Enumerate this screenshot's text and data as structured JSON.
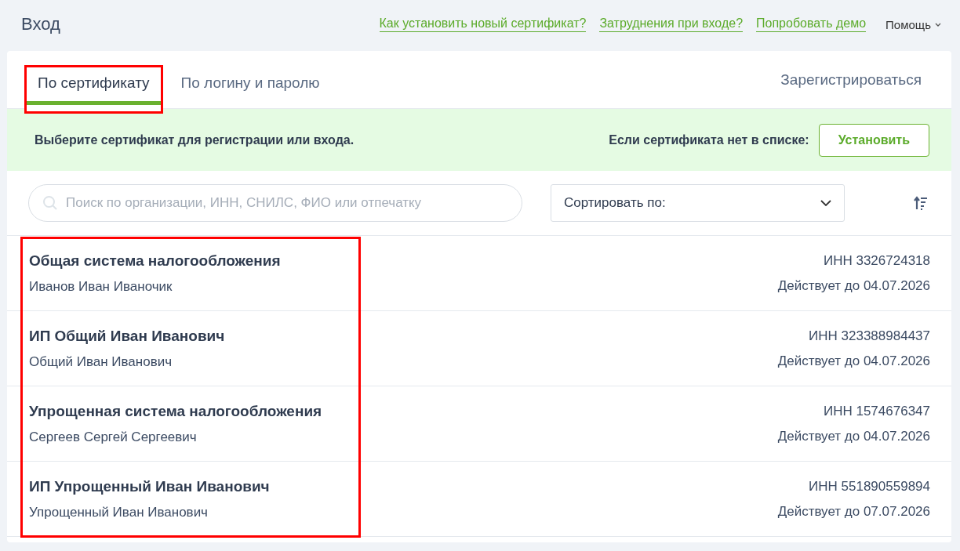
{
  "header": {
    "title": "Вход",
    "links": [
      "Как установить новый сертификат?",
      "Затруднения при входе?",
      "Попробовать демо"
    ],
    "help": "Помощь"
  },
  "tabs": [
    {
      "label": "По сертификату",
      "selected": true,
      "highlighted": true
    },
    {
      "label": "По логину и паролю",
      "selected": false,
      "highlighted": false
    }
  ],
  "register_link": "Зарегистрироваться",
  "banner": {
    "message": "Выберите сертификат для регистрации или входа.",
    "hint": "Если сертификата нет в списке:",
    "button": "Установить"
  },
  "search": {
    "placeholder": "Поиск по организации, ИНН, СНИЛС, ФИО или отпечатку"
  },
  "sort": {
    "label": "Сортировать по:"
  },
  "certificates_highlighted": true,
  "certificates": [
    {
      "organization": "Общая система налогообложения",
      "owner": "Иванов Иван Иваночик",
      "inn": "ИНН 3326724318",
      "valid": "Действует до 04.07.2026"
    },
    {
      "organization": "ИП Общий Иван Иванович",
      "owner": "Общий Иван Иванович",
      "inn": "ИНН 323388984437",
      "valid": "Действует до 04.07.2026"
    },
    {
      "organization": "Упрощенная система налогообложения",
      "owner": "Сергеев Сергей Сергеевич",
      "inn": "ИНН 1574676347",
      "valid": "Действует до 04.07.2026"
    },
    {
      "organization": "ИП Упрощенный Иван Иванович",
      "owner": "Упрощенный Иван Иванович",
      "inn": "ИНН 551890559894",
      "valid": "Действует до 07.07.2026"
    }
  ]
}
